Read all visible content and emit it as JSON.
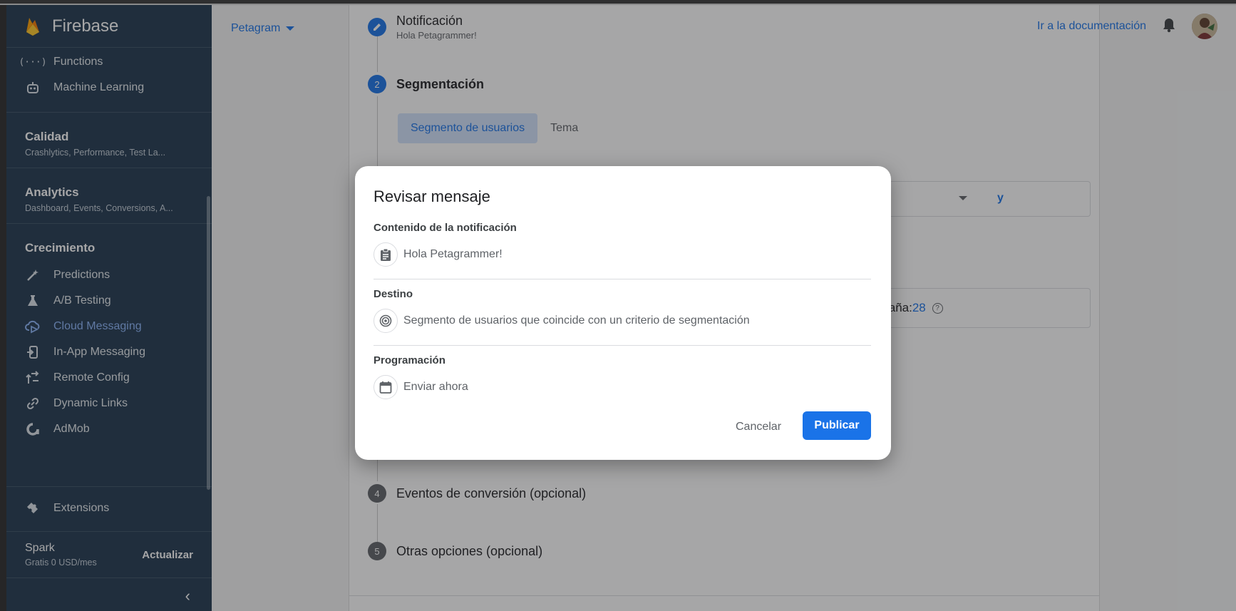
{
  "brand": {
    "name": "Firebase"
  },
  "sidebar": {
    "top_items": [
      {
        "label": "Functions",
        "icon": "functions-icon"
      },
      {
        "label": "Machine Learning",
        "icon": "robot-icon"
      }
    ],
    "sections": [
      {
        "title": "Calidad",
        "subtitle": "Crashlytics, Performance, Test La..."
      },
      {
        "title": "Analytics",
        "subtitle": "Dashboard, Events, Conversions, A..."
      }
    ],
    "growth": {
      "title": "Crecimiento",
      "items": [
        {
          "label": "Predictions",
          "icon": "wand-icon"
        },
        {
          "label": "A/B Testing",
          "icon": "flask-icon"
        },
        {
          "label": "Cloud Messaging",
          "icon": "cloud-send-icon",
          "active": true
        },
        {
          "label": "In-App Messaging",
          "icon": "in-app-icon"
        },
        {
          "label": "Remote Config",
          "icon": "remote-config-icon"
        },
        {
          "label": "Dynamic Links",
          "icon": "link-icon"
        },
        {
          "label": "AdMob",
          "icon": "admob-icon"
        }
      ]
    },
    "extensions": {
      "label": "Extensions",
      "icon": "puzzle-icon"
    },
    "plan": {
      "name": "Spark",
      "price": "Gratis 0 USD/mes",
      "upgrade": "Actualizar"
    }
  },
  "header": {
    "project": "Petagram",
    "doc_link": "Ir a la documentación"
  },
  "steps": [
    {
      "num": "",
      "title": "Notificación",
      "subtitle": "Hola Petagrammer!"
    },
    {
      "num": "2",
      "title": "Segmentación"
    },
    {
      "num": "4",
      "title": "Eventos de conversión (opcional)"
    },
    {
      "num": "5",
      "title": "Otras opciones (opcional)"
    }
  ],
  "targeting": {
    "tabs": [
      "Segmento de usuarios",
      "Tema"
    ],
    "and_label": "y",
    "reach_text": "a campaña:",
    "reach_count": "28"
  },
  "dialog": {
    "title": "Revisar mensaje",
    "content_label": "Contenido de la notificación",
    "content_value": "Hola Petagrammer!",
    "target_label": "Destino",
    "target_value": "Segmento de usuarios que coincide con un criterio de segmentación",
    "schedule_label": "Programación",
    "schedule_value": "Enviar ahora",
    "cancel": "Cancelar",
    "publish": "Publicar"
  },
  "colors": {
    "accent": "#1a73e8",
    "sidebar": "#20384f",
    "active_nav": "#8ab4f8"
  }
}
